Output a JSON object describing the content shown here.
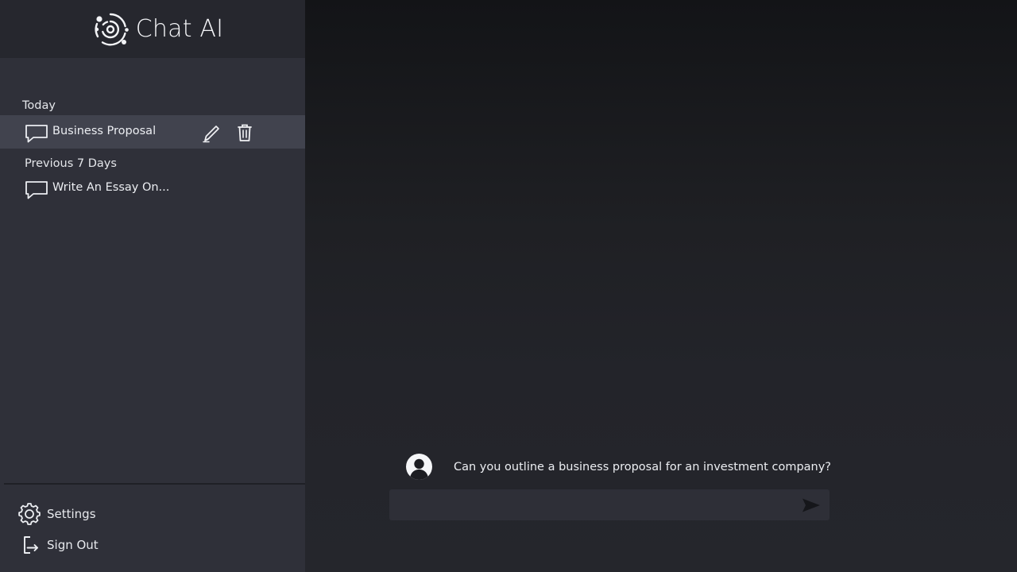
{
  "app": {
    "title": "Chat AI"
  },
  "sidebar": {
    "sections": [
      {
        "label": "Today",
        "conversations": [
          {
            "title": "Business Proposal",
            "active": true
          }
        ]
      },
      {
        "label": "Previous 7 Days",
        "conversations": [
          {
            "title": "Write An Essay On..."
          }
        ]
      }
    ],
    "bottom": {
      "settings_label": "Settings",
      "signout_label": "Sign Out"
    }
  },
  "chat": {
    "messages": [
      {
        "role": "user",
        "text": "Can you outline a business proposal for an investment company?"
      }
    ],
    "composer": {
      "value": "",
      "placeholder": ""
    }
  },
  "icons": {
    "brand": "chat-ai-logo",
    "conversation": "speech-bubble-icon",
    "edit": "pencil-icon",
    "delete": "trash-icon",
    "settings": "gear-icon",
    "signout": "sign-out-icon",
    "avatar": "user-avatar-icon",
    "send": "send-arrow-icon"
  },
  "colors": {
    "sidebar_bg": "#2f3039",
    "sidebar_header_bg": "#26272e",
    "active_item_bg": "#41434e",
    "main_bg_top": "#131417",
    "main_bg_bottom": "#25262c",
    "composer_bg": "#2e2f37",
    "text": "#e9eaee"
  }
}
